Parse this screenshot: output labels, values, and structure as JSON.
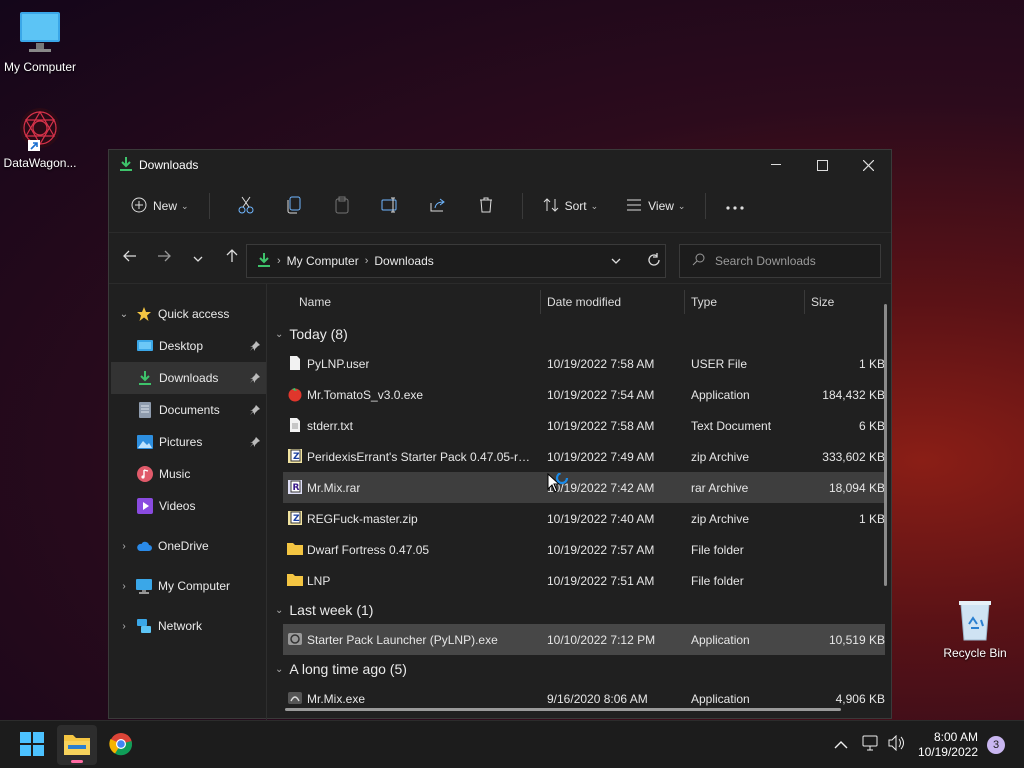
{
  "desktop": {
    "icons": [
      {
        "label": "My Computer"
      },
      {
        "label": "DataWagon..."
      },
      {
        "label": "Recycle Bin"
      }
    ]
  },
  "window": {
    "title": "Downloads",
    "toolbar": {
      "new_label": "New",
      "sort_label": "Sort",
      "view_label": "View"
    },
    "address": {
      "crumbs": [
        "My Computer",
        "Downloads"
      ]
    },
    "search": {
      "placeholder": "Search Downloads"
    }
  },
  "sidebar": {
    "items": [
      {
        "label": "Quick access"
      },
      {
        "label": "Desktop"
      },
      {
        "label": "Downloads"
      },
      {
        "label": "Documents"
      },
      {
        "label": "Pictures"
      },
      {
        "label": "Music"
      },
      {
        "label": "Videos"
      },
      {
        "label": "OneDrive"
      },
      {
        "label": "My Computer"
      },
      {
        "label": "Network"
      }
    ]
  },
  "columns": {
    "name": "Name",
    "date": "Date modified",
    "type": "Type",
    "size": "Size"
  },
  "groups": [
    {
      "label": "Today (8)",
      "files": [
        {
          "name": "PyLNP.user",
          "date": "10/19/2022 7:58 AM",
          "type": "USER File",
          "size": "1 KB",
          "icon": "file-icon"
        },
        {
          "name": "Mr.TomatoS_v3.0.exe",
          "date": "10/19/2022 7:54 AM",
          "type": "Application",
          "size": "184,432 KB",
          "icon": "tomato-app-icon"
        },
        {
          "name": "stderr.txt",
          "date": "10/19/2022 7:58 AM",
          "type": "Text Document",
          "size": "6 KB",
          "icon": "text-file-icon"
        },
        {
          "name": "PeridexisErrant's Starter Pack 0.47.05-r10....",
          "date": "10/19/2022 7:49 AM",
          "type": "zip Archive",
          "size": "333,602 KB",
          "icon": "zip-archive-icon"
        },
        {
          "name": "Mr.Mix.rar",
          "date": "10/19/2022 7:42 AM",
          "type": "rar Archive",
          "size": "18,094 KB",
          "icon": "rar-archive-icon"
        },
        {
          "name": "REGFuck-master.zip",
          "date": "10/19/2022 7:40 AM",
          "type": "zip Archive",
          "size": "1 KB",
          "icon": "zip-archive-icon"
        },
        {
          "name": "Dwarf Fortress 0.47.05",
          "date": "10/19/2022 7:57 AM",
          "type": "File folder",
          "size": "",
          "icon": "folder-icon"
        },
        {
          "name": "LNP",
          "date": "10/19/2022 7:51 AM",
          "type": "File folder",
          "size": "",
          "icon": "folder-icon"
        }
      ]
    },
    {
      "label": "Last week (1)",
      "files": [
        {
          "name": "Starter Pack Launcher (PyLNP).exe",
          "date": "10/10/2022 7:12 PM",
          "type": "Application",
          "size": "10,519 KB",
          "icon": "launcher-app-icon"
        }
      ]
    },
    {
      "label": "A long time ago (5)",
      "files": [
        {
          "name": "Mr.Mix.exe",
          "date": "9/16/2020 8:06 AM",
          "type": "Application",
          "size": "4,906 KB",
          "icon": "mix-app-icon"
        }
      ]
    }
  ],
  "taskbar": {
    "time": "8:00 AM",
    "date": "10/19/2022",
    "notification_count": "3"
  },
  "colors": {
    "accent": "#0078d4",
    "folder": "#f4c542",
    "download_green": "#3ec36b"
  }
}
